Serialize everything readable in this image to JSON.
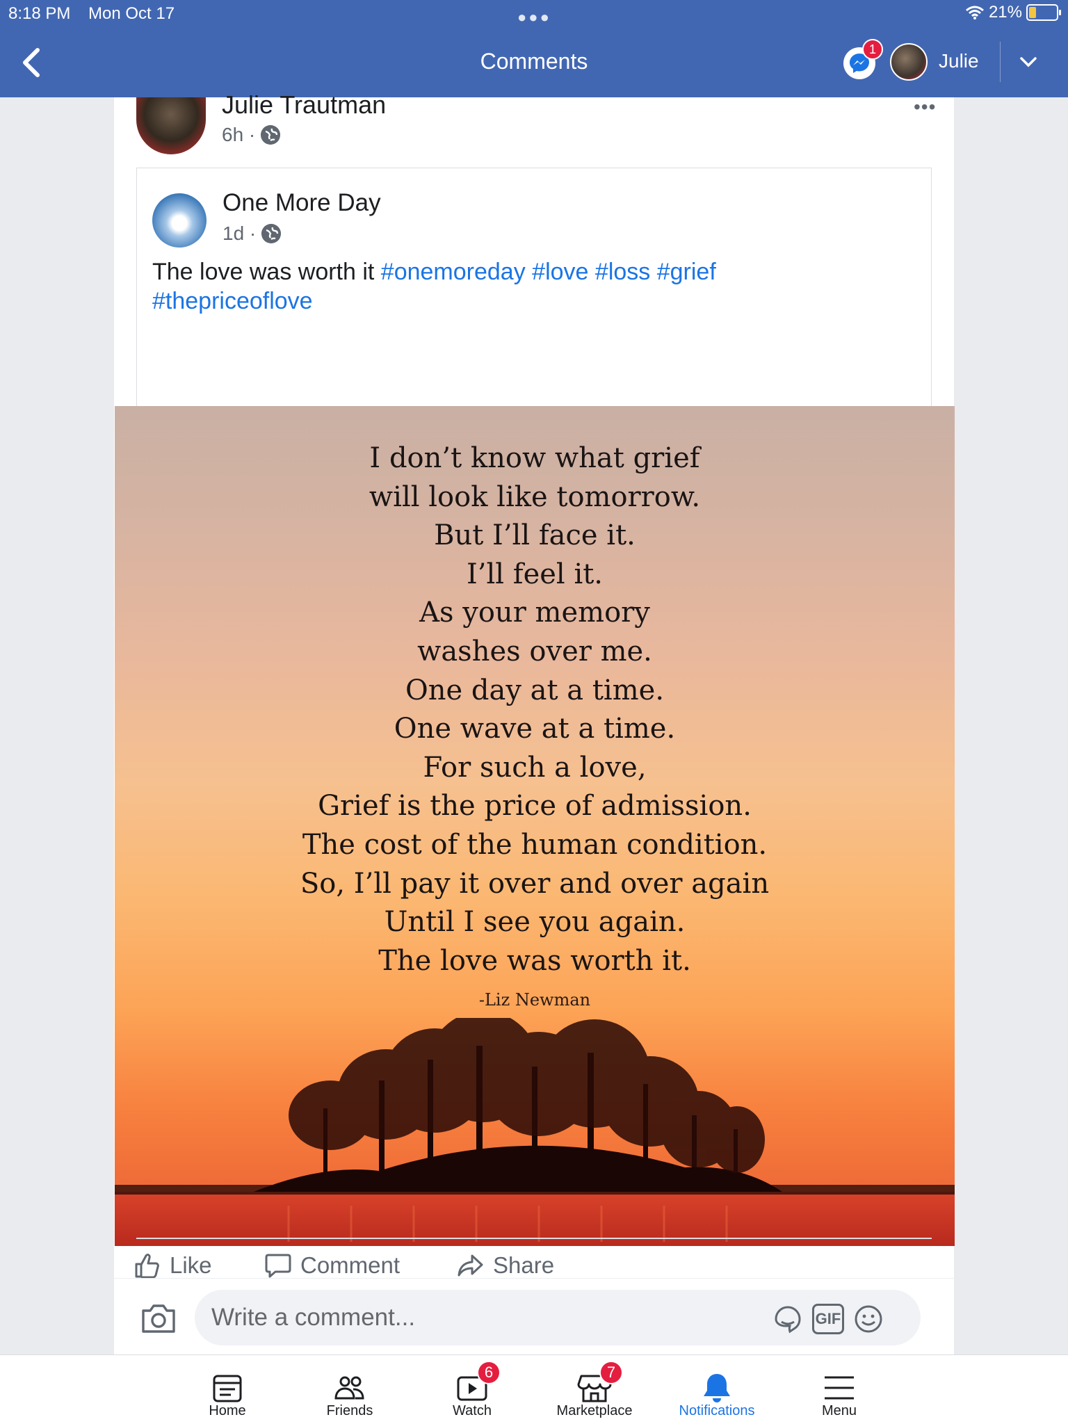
{
  "status_bar": {
    "time": "8:18 PM",
    "date": "Mon Oct 17",
    "battery": "21%"
  },
  "nav": {
    "title": "Comments",
    "messenger_badge": "1",
    "user_name": "Julie"
  },
  "post": {
    "author": "Julie Trautman",
    "time": "6h ·",
    "shared": {
      "page_name": "One More Day",
      "time": "1d ·",
      "text": "The love was worth it ",
      "hashtags": [
        "#onemoreday",
        "#love",
        "#loss",
        "#grief",
        "#thepriceoflove"
      ],
      "image_lines": [
        "I don’t know what grief",
        "will look like tomorrow.",
        "But I’ll face it.",
        "I’ll feel it.",
        "As your memory",
        "washes over me.",
        "One day at a time.",
        "One wave at a time.",
        "For such a love,",
        "Grief is the price of admission.",
        "The cost of the human condition.",
        "So, I’ll pay it over and over again",
        "Until I see you again.",
        "The love was worth it."
      ],
      "image_attribution": "-Liz Newman"
    },
    "actions": {
      "like": "Like",
      "comment": "Comment",
      "share": "Share"
    },
    "comment_placeholder": "Write a comment...",
    "gif_label": "GIF"
  },
  "tabbar": [
    {
      "label": "Home",
      "icon": "home-icon"
    },
    {
      "label": "Friends",
      "icon": "friends-icon"
    },
    {
      "label": "Watch",
      "icon": "watch-icon",
      "badge": "6"
    },
    {
      "label": "Marketplace",
      "icon": "marketplace-icon",
      "badge": "7"
    },
    {
      "label": "Notifications",
      "icon": "bell-icon",
      "active": true
    },
    {
      "label": "Menu",
      "icon": "menu-icon"
    }
  ],
  "colors": {
    "header": "#4267b2",
    "link": "#1b74e4",
    "badge": "#e41e3f"
  }
}
